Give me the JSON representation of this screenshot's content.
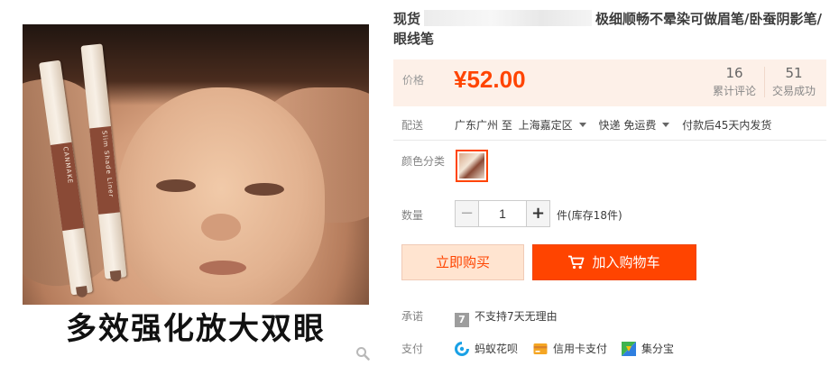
{
  "product": {
    "title_before": "现货",
    "title_after": "极细顺畅不晕染可做眉笔/卧蚕阴影笔/眼线笔",
    "image_caption": "多效强化放大双眼",
    "pencil_brand": "CANMAKE",
    "pencil_sub": "Slim Shade Liner"
  },
  "price": {
    "label": "价格",
    "value": "¥52.00",
    "reviews_count": "16",
    "reviews_label": "累计评论",
    "sales_count": "51",
    "sales_label": "交易成功"
  },
  "shipping": {
    "label": "配送",
    "from": "广东广州 至",
    "to": "上海嘉定区",
    "method": "快递 免运费",
    "dispatch": "付款后45天内发货"
  },
  "variant": {
    "label": "颜色分类",
    "selected_color": "#ff4400"
  },
  "quantity": {
    "label": "数量",
    "minus": "−",
    "plus": "+",
    "value": "1",
    "stock_text": "件(库存18件)"
  },
  "actions": {
    "buy_now": "立即购买",
    "add_to_cart": "加入购物车"
  },
  "promise": {
    "label": "承诺",
    "icon_text": "7",
    "text": "不支持7天无理由"
  },
  "payment": {
    "label": "支付",
    "methods": [
      {
        "name": "蚂蚁花呗",
        "icon": "huabei-icon"
      },
      {
        "name": "信用卡支付",
        "icon": "credit-card-icon"
      },
      {
        "name": "集分宝",
        "icon": "jifenbao-icon"
      }
    ]
  },
  "colors": {
    "accent": "#ff4400",
    "price_bg": "#fdf0e8",
    "buy_bg": "#ffe4d0"
  }
}
